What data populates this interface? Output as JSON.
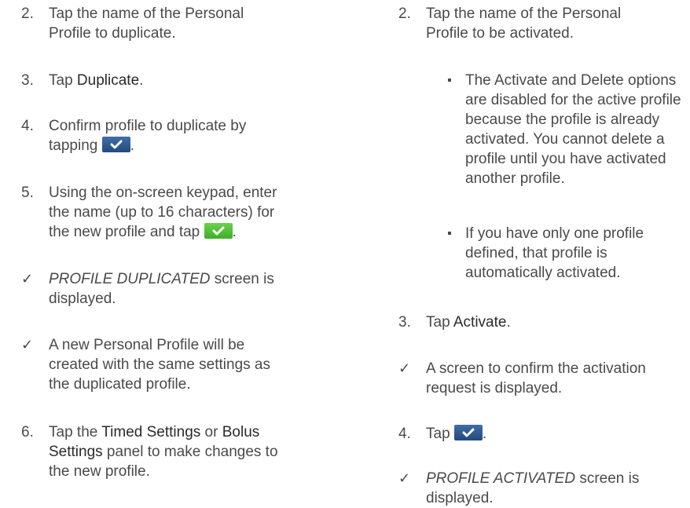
{
  "left": {
    "step2": {
      "num": "2.",
      "line1": "Tap the name of the Personal",
      "line2": "Profile to duplicate."
    },
    "step3": {
      "num": "3.",
      "pre": "Tap ",
      "bold": "Duplicate",
      "post": "."
    },
    "step4": {
      "num": "4.",
      "line1": "Confirm profile to duplicate by",
      "pre": "tapping ",
      "post": "."
    },
    "step5": {
      "num": "5.",
      "line1": "Using the on-screen keypad, enter",
      "line2": "the name (up to 16 characters) for",
      "pre": "the new profile and tap ",
      "post": "."
    },
    "result1": {
      "mark": "✓",
      "italic": "PROFILE DUPLICATED",
      "rest": " screen is",
      "line2": "displayed."
    },
    "result2": {
      "mark": "✓",
      "line1": "A new Personal Profile will be",
      "line2": "created with the same settings as",
      "line3": "the duplicated profile."
    },
    "step6": {
      "num": "6.",
      "pre": "Tap the ",
      "bold1": "Timed Settings",
      "mid": " or ",
      "bold2": "Bolus",
      "bold3": "Settings",
      "post": " panel to make changes to",
      "line3": "the new profile."
    }
  },
  "right": {
    "step2": {
      "num": "2.",
      "line1": "Tap the name of the Personal",
      "line2": "Profile to be activated."
    },
    "bullet1": {
      "line1": "The Activate and Delete options",
      "line2": "are disabled for the active profile",
      "line3": "because the profile is already",
      "line4": "activated. You cannot delete a",
      "line5": "profile until you have activated",
      "line6": "another profile."
    },
    "bullet2": {
      "line1": "If you have only one profile",
      "line2": "defined, that profile is",
      "line3": "automatically activated."
    },
    "step3": {
      "num": "3.",
      "pre": "Tap ",
      "bold": "Activate",
      "post": "."
    },
    "result1": {
      "mark": "✓",
      "line1": "A screen to confirm the activation",
      "line2": "request is displayed."
    },
    "step4": {
      "num": "4.",
      "pre": "Tap ",
      "post": "."
    },
    "result2": {
      "mark": "✓",
      "italic": "PROFILE ACTIVATED",
      "rest": " screen is",
      "line2": "displayed."
    }
  },
  "icons": {
    "confirm_blue": "check-button-blue",
    "confirm_green": "check-button-green",
    "blue": "#2f5c95",
    "green": "#52c23a"
  }
}
